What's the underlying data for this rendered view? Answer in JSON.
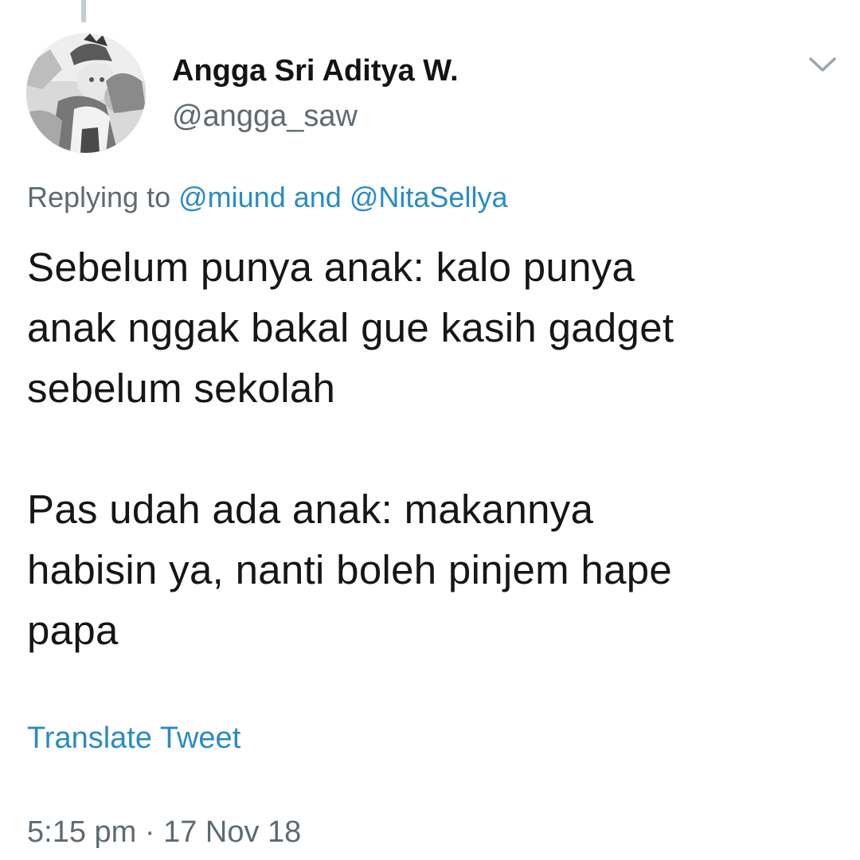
{
  "tweet": {
    "author": {
      "display_name": "Angga Sri Aditya W.",
      "handle": "@angga_saw"
    },
    "reply_context": {
      "prefix": "Replying to",
      "mention_1": "@miund",
      "conjunction": "and",
      "mention_2": "@NitaSellya"
    },
    "body": {
      "paragraph_1_lines": [
        "Sebelum punya anak: kalo punya",
        "anak nggak bakal gue kasih gadget",
        "sebelum sekolah"
      ],
      "paragraph_2_lines": [
        "Pas udah ada anak: makannya",
        "habisin ya, nanti boleh pinjem hape",
        "papa"
      ]
    },
    "translate_label": "Translate Tweet",
    "time": "5:15 pm",
    "separator": "·",
    "date": "17 Nov 18"
  },
  "icons": {
    "menu": "chevron-down-icon",
    "avatar": "profile-photo"
  },
  "colors": {
    "link": "#2a8cc4",
    "secondary_text": "#5f6a72",
    "primary_text": "#161616"
  }
}
